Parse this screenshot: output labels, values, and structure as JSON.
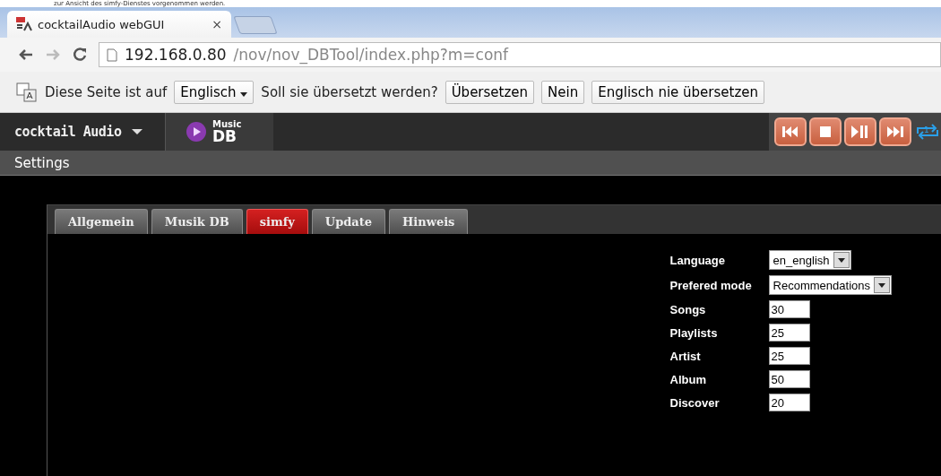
{
  "top_caption": "zur Ansicht des simfy-Dienstes vorgenommen werden.",
  "browser": {
    "tab_title": "cocktailAudio webGUI",
    "tab_close": "×",
    "url_host": "192.168.0.80",
    "url_path": "/nov/nov_DBTool/index.php?m=conf"
  },
  "translate_bar": {
    "prefix": "Diese Seite ist auf",
    "language": "Englisch",
    "question": "Soll sie übersetzt werden?",
    "buttons": [
      "Übersetzen",
      "Nein",
      "Englisch nie übersetzen"
    ]
  },
  "app": {
    "logo": "cocktail Audio",
    "musicdb_top": "Music",
    "musicdb_bottom": "DB",
    "repeat_badge": "1"
  },
  "settings_title": "Settings",
  "tabs": [
    {
      "label": "Allgemein",
      "selected": false
    },
    {
      "label": "Musik DB",
      "selected": false
    },
    {
      "label": "simfy",
      "selected": true
    },
    {
      "label": "Update",
      "selected": false
    },
    {
      "label": "Hinweis",
      "selected": false
    }
  ],
  "fields": [
    {
      "label": "Language",
      "kind": "select",
      "value": "en_english"
    },
    {
      "label": "Prefered mode",
      "kind": "select",
      "value": "Recommendations"
    },
    {
      "label": "Songs",
      "kind": "input",
      "value": "30"
    },
    {
      "label": "Playlists",
      "kind": "input",
      "value": "25"
    },
    {
      "label": "Artist",
      "kind": "input",
      "value": "25"
    },
    {
      "label": "Album",
      "kind": "input",
      "value": "50"
    },
    {
      "label": "Discover",
      "kind": "input",
      "value": "20"
    }
  ]
}
